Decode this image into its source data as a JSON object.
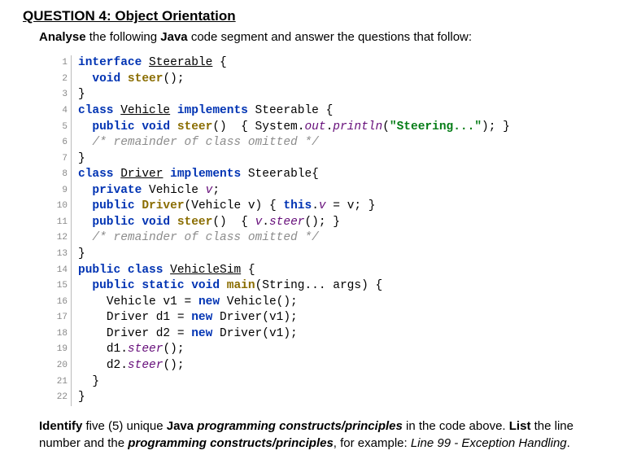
{
  "title": "QUESTION 4: Object Orientation",
  "intro": {
    "p1": "Analyse",
    "p2": " the following ",
    "p3": "Java",
    "p4": " code segment and answer the questions that follow:"
  },
  "code": {
    "l1_a": "interface",
    "l1_b": "Steerable",
    "l1_c": " {",
    "l2_a": "void",
    "l2_b": "steer",
    "l2_c": "();",
    "l3": "}",
    "l4_a": "class",
    "l4_b": "Vehicle",
    "l4_c": "implements",
    "l4_d": " Steerable {",
    "l5_a": "public void",
    "l5_b": "steer",
    "l5_c": "()  { System.",
    "l5_d": "out",
    "l5_e": ".",
    "l5_f": "println",
    "l5_g": "(",
    "l5_h": "\"Steering...\"",
    "l5_i": "); }",
    "l6": "/* remainder of class omitted */",
    "l7": "}",
    "l8_a": "class",
    "l8_b": "Driver",
    "l8_c": "implements",
    "l8_d": " Steerable{",
    "l9_a": "private",
    "l9_b": " Vehicle ",
    "l9_c": "v",
    "l9_d": ";",
    "l10_a": "public",
    "l10_b": "Driver",
    "l10_c": "(Vehicle v) { ",
    "l10_d": "this",
    "l10_e": ".",
    "l10_f": "v",
    "l10_g": " = v; }",
    "l11_a": "public void",
    "l11_b": "steer",
    "l11_c": "()  { ",
    "l11_d": "v",
    "l11_e": ".",
    "l11_f": "steer",
    "l11_g": "(); }",
    "l12": "/* remainder of class omitted */",
    "l13": "}",
    "l14_a": "public class",
    "l14_b": "VehicleSim",
    "l14_c": " {",
    "l15_a": "public static void",
    "l15_b": "main",
    "l15_c": "(String... args) {",
    "l16_a": "Vehicle v1 = ",
    "l16_b": "new",
    "l16_c": " Vehicle();",
    "l17_a": "Driver d1 = ",
    "l17_b": "new",
    "l17_c": " Driver(v1);",
    "l18_a": "Driver d2 = ",
    "l18_b": "new",
    "l18_c": " Driver(v1);",
    "l19_a": "d1.",
    "l19_b": "steer",
    "l19_c": "();",
    "l20_a": "d2.",
    "l20_b": "steer",
    "l20_c": "();",
    "l21": "}",
    "l22": "}",
    "ln": {
      "n1": "1",
      "n2": "2",
      "n3": "3",
      "n4": "4",
      "n5": "5",
      "n6": "6",
      "n7": "7",
      "n8": "8",
      "n9": "9",
      "n10": "10",
      "n11": "11",
      "n12": "12",
      "n13": "13",
      "n14": "14",
      "n15": "15",
      "n16": "16",
      "n17": "17",
      "n18": "18",
      "n19": "19",
      "n20": "20",
      "n21": "21",
      "n22": "22"
    }
  },
  "outro": {
    "p1": "Identify",
    "p2": " five (5) unique ",
    "p3": "Java",
    "p4": " ",
    "p5": "programming constructs/principles",
    "p6": " in the code above.  ",
    "p7": "List",
    "p8": " the line number and the ",
    "p9": "programming constructs/principles",
    "p10": ", for example: ",
    "p11": "Line 99 - Exception Handling",
    "p12": "."
  }
}
